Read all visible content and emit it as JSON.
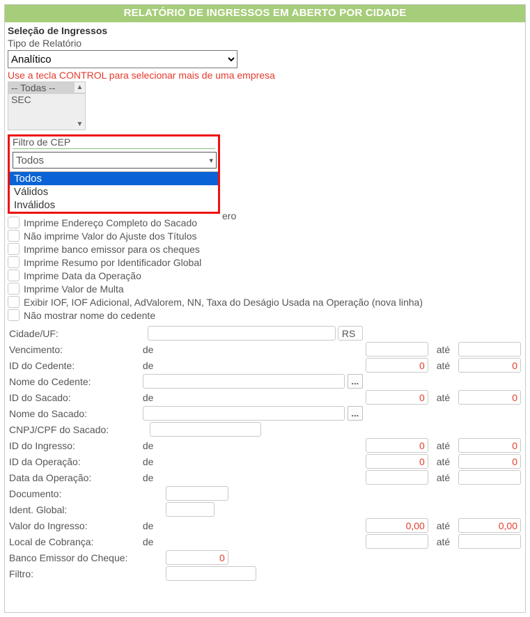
{
  "title": "RELATÓRIO DE INGRESSOS EM ABERTO POR CIDADE",
  "section": "Seleção de Ingressos",
  "tipo_label": "Tipo de Relatório",
  "tipo_value": "Analítico",
  "hint": "Use a tecla CONTROL para selecionar mais de uma empresa",
  "empresas": {
    "opt0": "-- Todas --",
    "opt1": "SEC"
  },
  "filtro_cep": {
    "label": "Filtro de CEP",
    "value": "Todos",
    "options": {
      "o0": "Todos",
      "o1": "Válidos",
      "o2": "Inválidos"
    }
  },
  "checks": {
    "c0": "Imprime Endereço Completo do Sacado",
    "c1": "Não imprime Valor do Ajuste dos Títulos",
    "c2": "Imprime banco emissor para os cheques",
    "c3": "Imprime Resumo por Identificador Global",
    "c4": "Imprime Data da Operação",
    "c5": "Imprime Valor de Multa",
    "c6": "Exibir IOF, IOF Adicional, AdValorem, NN, Taxa do Deságio Usada na Operação (nova linha)",
    "c7": "Não mostrar nome do cedente"
  },
  "hidden_check_tail": "ero",
  "labels": {
    "cidade": "Cidade/UF:",
    "venc": "Vencimento:",
    "id_cedente": "ID do Cedente:",
    "nome_cedente": "Nome do Cedente:",
    "id_sacado": "ID do Sacado:",
    "nome_sacado": "Nome do Sacado:",
    "cnpj": "CNPJ/CPF do Sacado:",
    "id_ingresso": "ID do Ingresso:",
    "id_operacao": "ID da Operação:",
    "data_operacao": "Data da Operação:",
    "documento": "Documento:",
    "ident_global": "Ident. Global:",
    "valor_ingresso": "Valor do Ingresso:",
    "local_cobranca": "Local de Cobrança:",
    "banco_emissor": "Banco Emissor do Cheque:",
    "filtro": "Filtro:",
    "de": "de",
    "ate": "até"
  },
  "vals": {
    "uf": "RS",
    "zero": "0",
    "zero_dec": "0,00"
  }
}
